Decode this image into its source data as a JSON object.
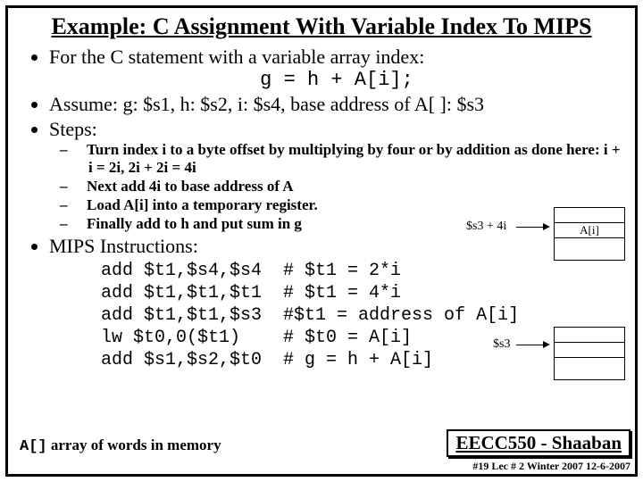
{
  "title": "Example:  C Assignment With Variable Index To MIPS",
  "bullets": {
    "intro": "For the C statement with a variable array index:",
    "cstmt": "g = h + A[i];",
    "assume": "Assume:   g: $s1,   h: $s2,   i: $s4,   base address of A[ ]: $s3",
    "steps_label": "Steps:",
    "mips_label": "MIPS Instructions:"
  },
  "steps": [
    "Turn index i to a byte offset by multiplying by four or by addition as done here:   i + i = 2i, 2i + 2i = 4i",
    "Next add 4i to base address of A",
    "Load A[i] into a temporary register.",
    "Finally add to h and put sum in g"
  ],
  "mips": {
    "instr": [
      "add $t1,$s4,$s4",
      "add $t1,$t1,$t1",
      "add $t1,$t1,$s3",
      "lw $t0,0($t1)",
      "add $s1,$s2,$t0"
    ],
    "comment": [
      "# $t1 = 2*i",
      "# $t1 = 4*i",
      "#$t1 = address of A[i]",
      "# $t0 = A[i]",
      "# g = h + A[i]"
    ]
  },
  "diagram1": {
    "ptr": "$s3 + 4i",
    "cell": "A[i]"
  },
  "diagram2": {
    "ptr": "$s3"
  },
  "footer": {
    "note_prefix": "A[]",
    "note_rest": " array of words in memory",
    "course": "EECC550 - Shaaban",
    "meta": "#19   Lec # 2  Winter 2007  12-6-2007"
  }
}
